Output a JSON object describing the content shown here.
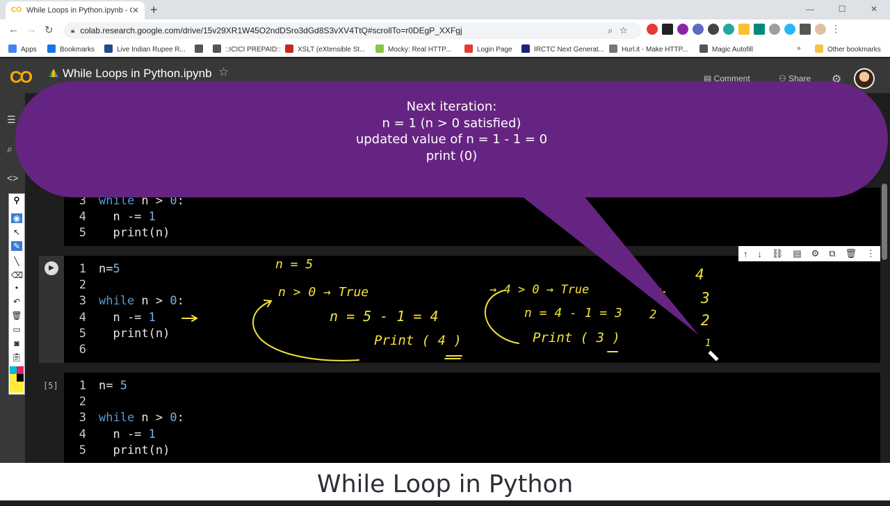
{
  "browser": {
    "tab_title": "While Loops in Python.ipynb - Co",
    "tab_favicon": "CO",
    "tab_close": "✕",
    "new_tab": "+",
    "url": "colab.research.google.com/drive/15v29XR1W45O2ndDSro3dGd8S3vXV4TtQ#scrollTo=r0DEgP_XXFgj",
    "bookmarks": [
      {
        "label": "Apps",
        "color": "#4285f4"
      },
      {
        "label": "Bookmarks",
        "color": "#1a73e8"
      },
      {
        "label": "Live Indian Rupee R...",
        "color": "#1b4f8a"
      },
      {
        "label": "",
        "color": "#555555"
      },
      {
        "label": "::ICICI PREPAID::",
        "color": "#555555"
      },
      {
        "label": "XSLT (eXtensible St...",
        "color": "#c62828"
      },
      {
        "label": "Mocky: Real HTTP...",
        "color": "#8bc34a"
      },
      {
        "label": "Login Page",
        "color": "#e53935"
      },
      {
        "label": "IRCTC Next Generat...",
        "color": "#1a237e"
      },
      {
        "label": "Hurl.it - Make HTTP...",
        "color": "#777777"
      },
      {
        "label": "Magic Autofill",
        "color": "#555555"
      }
    ],
    "bookmarks_overflow": "»",
    "other_bookmarks": "Other bookmarks"
  },
  "colab": {
    "logo": "CO",
    "notebook_title": "While Loops in Python.ipynb",
    "comment_label": "Comment",
    "share_label": "Share"
  },
  "cells": [
    {
      "exec_count": "",
      "lines": [
        {
          "n": "3",
          "parts": [
            [
              "kw",
              "while"
            ],
            [
              "txt",
              " n > "
            ],
            [
              "num",
              "0"
            ],
            [
              "txt",
              ":"
            ]
          ]
        },
        {
          "n": "4",
          "parts": [
            [
              "txt",
              "  n -= "
            ],
            [
              "num",
              "1"
            ]
          ]
        },
        {
          "n": "5",
          "parts": [
            [
              "txt",
              "  print(n)"
            ]
          ]
        }
      ]
    },
    {
      "exec_count": "",
      "lines": [
        {
          "n": "1",
          "parts": [
            [
              "txt",
              "n="
            ],
            [
              "num",
              "5"
            ]
          ]
        },
        {
          "n": "2",
          "parts": [
            [
              "txt",
              ""
            ]
          ]
        },
        {
          "n": "3",
          "parts": [
            [
              "kw",
              "while"
            ],
            [
              "txt",
              " n > "
            ],
            [
              "num",
              "0"
            ],
            [
              "txt",
              ":"
            ]
          ]
        },
        {
          "n": "4",
          "parts": [
            [
              "txt",
              "  n -= "
            ],
            [
              "num",
              "1"
            ]
          ]
        },
        {
          "n": "5",
          "parts": [
            [
              "txt",
              "  print(n)"
            ]
          ]
        },
        {
          "n": "6",
          "parts": [
            [
              "txt",
              ""
            ]
          ]
        }
      ]
    },
    {
      "exec_count": "[5]",
      "lines": [
        {
          "n": "1",
          "parts": [
            [
              "txt",
              "n= "
            ],
            [
              "num",
              "5"
            ]
          ]
        },
        {
          "n": "2",
          "parts": [
            [
              "txt",
              ""
            ]
          ]
        },
        {
          "n": "3",
          "parts": [
            [
              "kw",
              "while"
            ],
            [
              "txt",
              " n > "
            ],
            [
              "num",
              "0"
            ],
            [
              "txt",
              ":"
            ]
          ]
        },
        {
          "n": "4",
          "parts": [
            [
              "txt",
              "  n -= "
            ],
            [
              "num",
              "1"
            ]
          ]
        },
        {
          "n": "5",
          "parts": [
            [
              "txt",
              "  print(n)"
            ]
          ]
        }
      ]
    }
  ],
  "callout": {
    "line1": "Next iteration:",
    "line2": "n = 1 (n > 0 satisfied)",
    "line3": "updated value of n  = 1 - 1 = 0",
    "line4": "print (0)",
    "color": "#662482"
  },
  "annotations": {
    "ink_color": "#f5e33a",
    "n_eq": "n = 5",
    "cond1": "n > 0  →  True",
    "calc1": "n =  5 - 1  = 4",
    "print1": "Print ( 4 )",
    "cond2": "→ 4 > 0 → True",
    "calc2": "n = 4 - 1 = 3",
    "print2": "Print ( 3 )",
    "side_2": "2",
    "seq": [
      "4",
      "3",
      "2",
      "1"
    ]
  },
  "footer_title": "While Loop in Python"
}
